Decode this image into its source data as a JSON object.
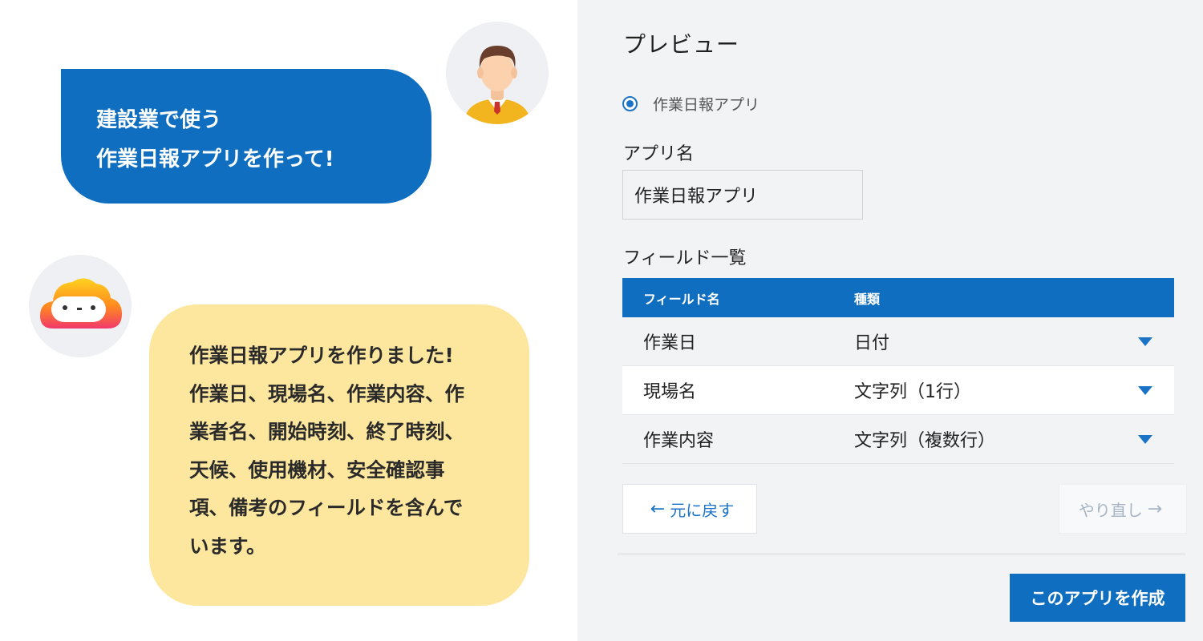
{
  "chat": {
    "user_message_lines": [
      "建設業で使う",
      "作業日報アプリを作って!"
    ],
    "bot_message_lines": [
      "作業日報アプリを作りました!",
      "作業日、現場名、作業内容、作",
      "業者名、開始時刻、終了時刻、",
      "天候、使用機材、安全確認事",
      "項、備考のフィールドを含んで",
      "います。"
    ]
  },
  "preview": {
    "title": "プレビュー",
    "radio_label": "作業日報アプリ",
    "app_name_label": "アプリ名",
    "app_name_value": "作業日報アプリ",
    "field_list_label": "フィールド一覧",
    "table": {
      "headers": [
        "フィールド名",
        "種類"
      ],
      "rows": [
        {
          "name": "作業日",
          "type": "日付"
        },
        {
          "name": "現場名",
          "type": "文字列（1行）"
        },
        {
          "name": "作業内容",
          "type": "文字列（複数行）"
        }
      ]
    },
    "undo_label": "元に戻す",
    "redo_label": "やり直し",
    "create_label": "このアプリを作成"
  },
  "colors": {
    "accent": "#0f6ebf",
    "user_bubble": "#0f6ebf",
    "bot_bubble": "#fde69d",
    "panel_bg": "#f2f3f5"
  }
}
